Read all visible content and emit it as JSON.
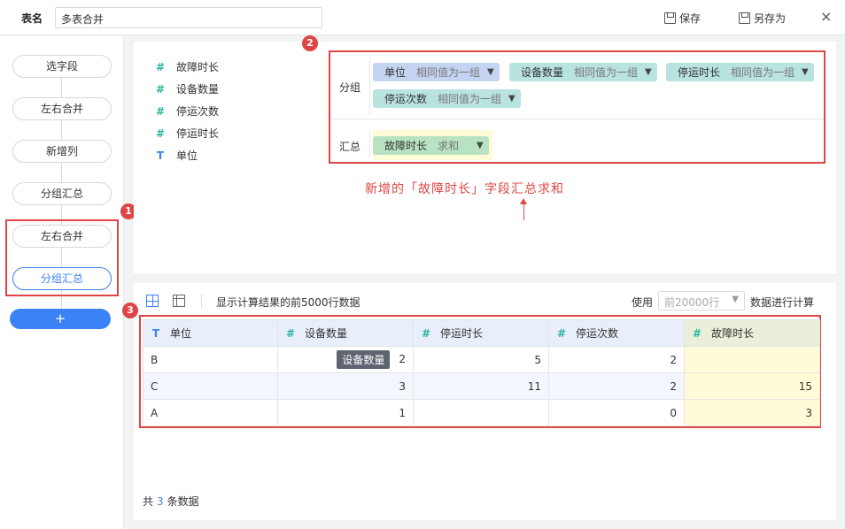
{
  "header": {
    "table_name_label": "表名",
    "table_name_value": "多表合并",
    "save_label": "保存",
    "save_as_label": "另存为",
    "close_icon": "×"
  },
  "sidebar": {
    "steps": [
      "选字段",
      "左右合并",
      "新增列",
      "分组汇总",
      "左右合并",
      "分组汇总"
    ],
    "active_step_index": 5,
    "add_label": "+"
  },
  "fields": [
    {
      "icon": "#",
      "type": "number",
      "label": "故障时长"
    },
    {
      "icon": "#",
      "type": "number",
      "label": "设备数量"
    },
    {
      "icon": "#",
      "type": "number",
      "label": "停运次数"
    },
    {
      "icon": "#",
      "type": "number",
      "label": "停运时长"
    },
    {
      "icon": "T",
      "type": "text",
      "label": "单位"
    }
  ],
  "grouping": {
    "group_label": "分组",
    "summary_label": "汇总",
    "group_chips": [
      {
        "name": "单位",
        "mode": "相同值为一组"
      },
      {
        "name": "设备数量",
        "mode": "相同值为一组"
      },
      {
        "name": "停运时长",
        "mode": "相同值为一组"
      },
      {
        "name": "停运次数",
        "mode": "相同值为一组"
      }
    ],
    "summary_chip": {
      "name": "故障时长",
      "mode": "求和"
    },
    "chip_colors": {
      "dimension": "#c5d4f2",
      "measure": "#b9e3df",
      "summary": "#b8e2c2"
    }
  },
  "annotation": "新增的「故障时长」字段汇总求和",
  "badges": [
    "1",
    "2",
    "3"
  ],
  "result": {
    "info": "显示计算结果的前5000行数据",
    "use_label": "使用",
    "limit_placeholder": "前20000行",
    "calc_label": "数据进行计算",
    "columns": [
      {
        "icon": "T",
        "type": "text",
        "label": "单位"
      },
      {
        "icon": "#",
        "type": "number",
        "label": "设备数量"
      },
      {
        "icon": "#",
        "type": "number",
        "label": "停运时长"
      },
      {
        "icon": "#",
        "type": "number",
        "label": "停运次数"
      },
      {
        "icon": "#",
        "type": "number",
        "label": "故障时长"
      }
    ],
    "rows": [
      [
        "B",
        "2",
        "5",
        "2",
        ""
      ],
      [
        "C",
        "3",
        "11",
        "2",
        "15"
      ],
      [
        "A",
        "1",
        "",
        "0",
        "3"
      ]
    ],
    "tooltip": "设备数量",
    "total_prefix": "共",
    "total_count": "3",
    "total_suffix": "条数据"
  },
  "colors": {
    "accent": "#3b82f6",
    "annotation_red": "#e04545",
    "highlight": "#fffbd6"
  }
}
